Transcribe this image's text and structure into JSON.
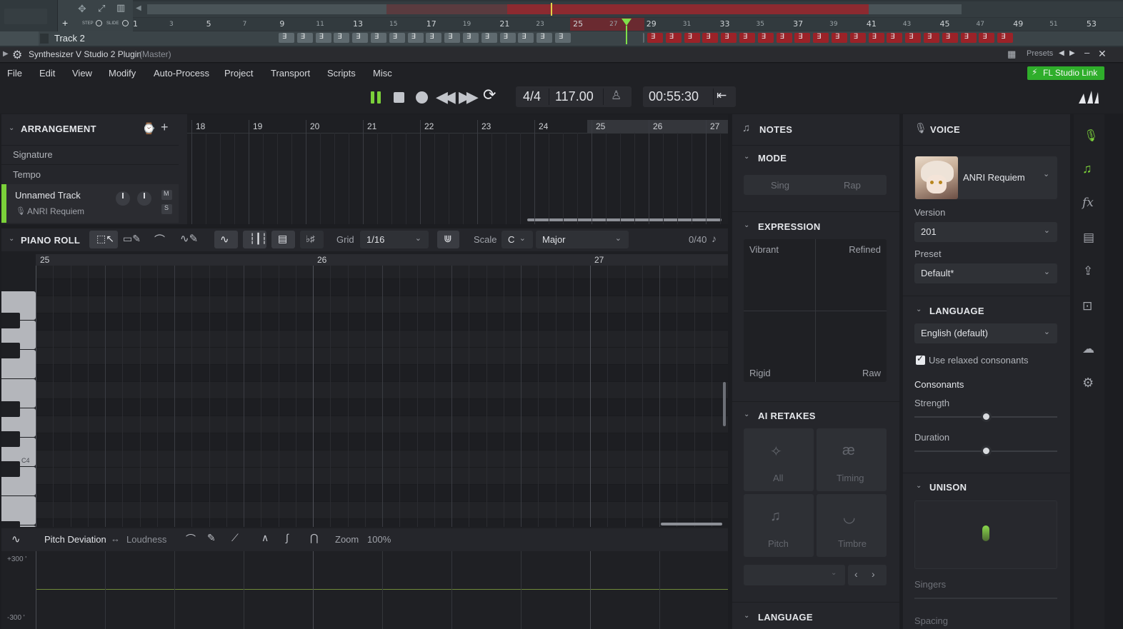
{
  "fl": {
    "track_name": "Track 2",
    "step_label": "STEP",
    "slide_label": "SLIDE",
    "ruler_major": [
      "1",
      "5",
      "9",
      "13",
      "17",
      "21",
      "25",
      "29",
      "33",
      "37",
      "41",
      "45",
      "49",
      "53"
    ],
    "ruler_minor": [
      "3",
      "7",
      "11",
      "15",
      "19",
      "23",
      "27",
      "31",
      "35",
      "39",
      "43",
      "47",
      "51"
    ],
    "clips_total": 40
  },
  "plugin": {
    "title": "Synthesizer V Studio 2 Plugin",
    "title_suffix": "(Master)",
    "presets_label": "Presets"
  },
  "menu": [
    "File",
    "Edit",
    "View",
    "Modify",
    "Auto-Process",
    "Project",
    "Transport",
    "Scripts",
    "Misc"
  ],
  "fl_link_label": "FL Studio Link",
  "transport": {
    "time_signature": "4/4",
    "tempo": "117.00",
    "time": "00:55:30"
  },
  "arrangement": {
    "title": "ARRANGEMENT",
    "rows": [
      "Signature",
      "Tempo"
    ],
    "track_name": "Unnamed Track",
    "track_voice": "ANRI Requiem",
    "mute_label": "M",
    "solo_label": "S",
    "bars": [
      "18",
      "19",
      "20",
      "21",
      "22",
      "23",
      "24",
      "25",
      "26",
      "27"
    ]
  },
  "piano_roll": {
    "title": "PIANO ROLL",
    "grid_label": "Grid",
    "grid_value": "1/16",
    "scale_label": "Scale",
    "scale_key": "C",
    "scale_mode": "Major",
    "note_count": "0/40",
    "bars": [
      "25",
      "26",
      "27"
    ],
    "c4_label": "C4"
  },
  "param": {
    "name": "Pitch Deviation",
    "alt": "Loudness",
    "zoom_label": "Zoom",
    "zoom_value": "100%",
    "top_value": "+300 '",
    "bottom_value": "-300 '"
  },
  "notes_panel": {
    "title": "NOTES",
    "mode_title": "MODE",
    "mode_sing": "Sing",
    "mode_rap": "Rap",
    "expression_title": "EXPRESSION",
    "expr_tl": "Vibrant",
    "expr_tr": "Refined",
    "expr_bl": "Rigid",
    "expr_br": "Raw",
    "retakes_title": "AI RETAKES",
    "retake_all": "All",
    "retake_timing": "Timing",
    "retake_pitch": "Pitch",
    "retake_timbre": "Timbre",
    "language_title": "LANGUAGE"
  },
  "voice_panel": {
    "title": "VOICE",
    "singer": "ANRI Requiem",
    "version_label": "Version",
    "version_value": "201",
    "preset_label": "Preset",
    "preset_value": "Default*",
    "language_title": "LANGUAGE",
    "language_value": "English (default)",
    "relaxed_label": "Use relaxed consonants",
    "relaxed_checked": true,
    "consonants_label": "Consonants",
    "strength_label": "Strength",
    "strength_value": 0.5,
    "duration_label": "Duration",
    "duration_value": 0.5,
    "unison_title": "UNISON",
    "singers_label": "Singers",
    "spacing_label": "Spacing"
  },
  "colors": {
    "accent_green": "#7bd13a",
    "fl_link_green": "#2fae2b",
    "clip_red": "#9b2228",
    "clip_gray": "#5f6a6f"
  }
}
